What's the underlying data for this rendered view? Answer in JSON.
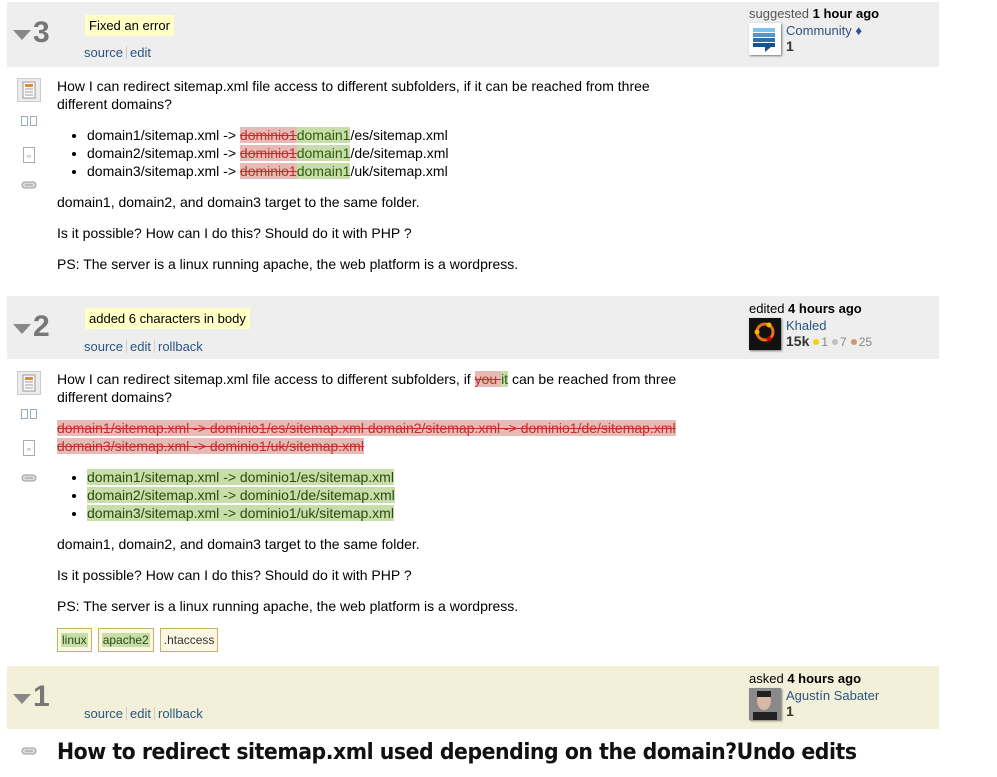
{
  "revisions": [
    {
      "number": "3",
      "comment": "Fixed an error",
      "links": [
        "source",
        "edit"
      ],
      "action": "suggested",
      "when": "1 hour ago",
      "user": {
        "name": "Community",
        "moderator_diamond": "♦",
        "reputation": "1",
        "avatar": "community-logo"
      },
      "body": {
        "intro": "How I can redirect sitemap.xml file access to different subfolders, if it can be reached from three different domains?",
        "list": [
          {
            "prefix": "domain1/sitemap.xml -> ",
            "deleted": "dominio1",
            "inserted": "domain1",
            "suffix": "/es/sitemap.xml"
          },
          {
            "prefix": "domain2/sitemap.xml -> ",
            "deleted": "dominio1",
            "inserted": "domain1",
            "suffix": "/de/sitemap.xml"
          },
          {
            "prefix": "domain3/sitemap.xml -> ",
            "deleted": "dominio1",
            "inserted": "domain1",
            "suffix": "/uk/sitemap.xml"
          }
        ],
        "paragraphs": [
          "domain1, domain2, and domain3 target to the same folder.",
          "Is it possible? How can I do this? Should do it with PHP ?",
          "PS: The server is a linux running apache, the web platform is a wordpress."
        ]
      }
    },
    {
      "number": "2",
      "comment": "added 6 characters in body",
      "links": [
        "source",
        "edit",
        "rollback"
      ],
      "action": "edited",
      "when": "4 hours ago",
      "user": {
        "name": "Khaled",
        "reputation": "15k",
        "gold": "1",
        "silver": "7",
        "bronze": "25",
        "avatar": "ubuntu-avatar"
      },
      "body": {
        "intro_before": "How I can redirect sitemap.xml file access to different subfolders, if ",
        "intro_deleted": "you ",
        "intro_inserted": "it",
        "intro_after": " can be reached from three different domains?",
        "deleted_block": "domain1/sitemap.xml -> dominio1/es/sitemap.xml domain2/sitemap.xml -> dominio1/de/sitemap.xml domain3/sitemap.xml -> dominio1/uk/sitemap.xml",
        "inserted_list": [
          "domain1/sitemap.xml -> dominio1/es/sitemap.xml",
          "domain2/sitemap.xml -> dominio1/de/sitemap.xml",
          "domain3/sitemap.xml -> dominio1/uk/sitemap.xml"
        ],
        "paragraphs": [
          "domain1, domain2, and domain3 target to the same folder.",
          "Is it possible? How can I do this? Should do it with PHP ?",
          "PS: The server is a linux running apache, the web platform is a wordpress."
        ],
        "tags": [
          {
            "label": "linux",
            "status": "inserted"
          },
          {
            "label": "apache2",
            "status": "inserted"
          },
          {
            "label": ".htaccess",
            "status": "unchanged"
          }
        ]
      }
    },
    {
      "number": "1",
      "links": [
        "source",
        "edit",
        "rollback"
      ],
      "action": "asked",
      "when": "4 hours ago",
      "user": {
        "name": "Agustín Sabater",
        "reputation": "1",
        "avatar": "user-photo"
      },
      "title": "How to redirect sitemap.xml used depending on the domain?Undo edits"
    }
  ],
  "colors": {
    "header_bg": "#eeeeee",
    "original_header_bg": "#f3f0da",
    "comment_bg": "#ffffc6",
    "link": "#2b5480",
    "deleted_bg": "#e7bab6",
    "inserted_bg": "#c7deaa",
    "gold": "#ffcc01",
    "silver": "#c0c0c0",
    "bronze": "#cc9966"
  }
}
